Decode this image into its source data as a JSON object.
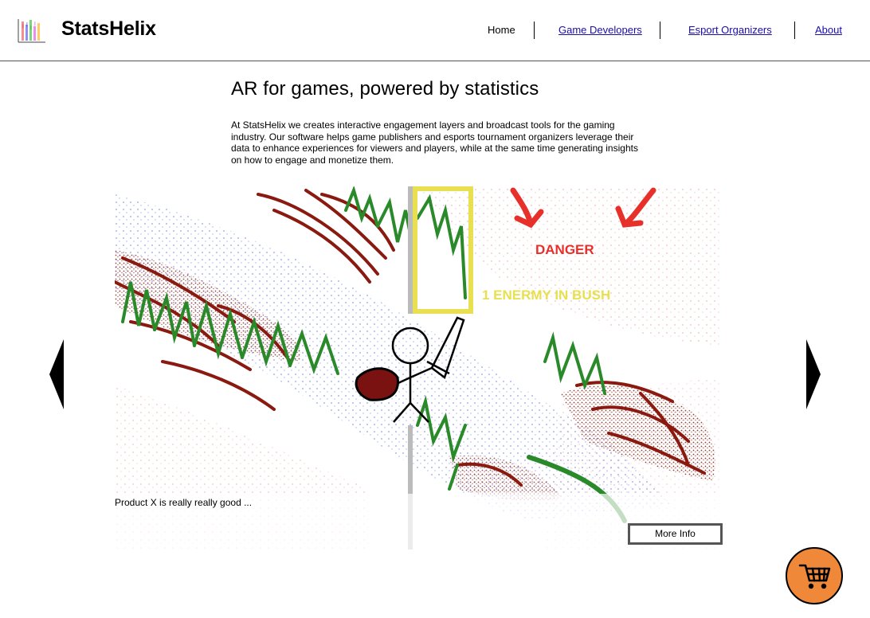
{
  "header": {
    "brand": "StatsHelix",
    "nav": {
      "home": "Home",
      "game_developers": "Game Developers",
      "esport_organizers": "Esport Organizers",
      "about": "About"
    }
  },
  "hero": {
    "title": "AR for games, powered by statistics",
    "text": "At StatsHelix we creates interactive engagement layers and broadcast tools for the gaming industry. Our software helps game publishers and esports tournament organizers leverage their data to enhance experiences for viewers and players, while at the same time generating insights on how to engage and monetize them."
  },
  "carousel": {
    "image_labels": {
      "danger": "DANGER",
      "enemy": "1 ENERMY IN BUSH"
    },
    "caption": "Product X is really really good ...",
    "more_info": "More Info",
    "prev_icon": "triangle-left-icon",
    "next_icon": "triangle-right-icon"
  },
  "cart": {
    "icon": "shopping-cart-icon"
  },
  "colors": {
    "cart_bg": "#f0883a",
    "link": "#1a0dab",
    "danger": "#e8302a",
    "highlight": "#e8e050"
  }
}
